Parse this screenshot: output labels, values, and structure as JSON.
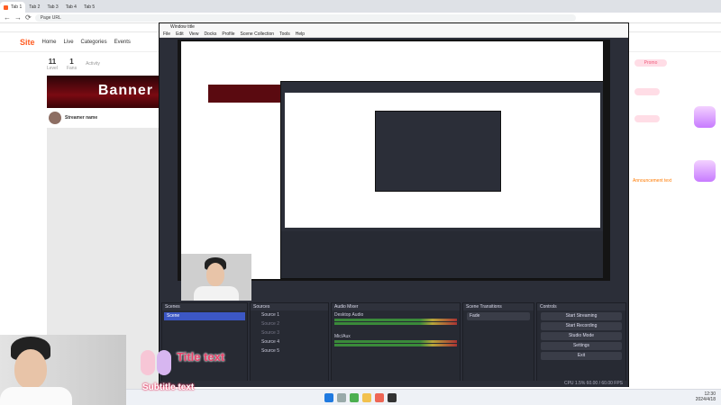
{
  "browser": {
    "tabs": [
      "Tab 1",
      "Tab 2",
      "Tab 3",
      "Tab 4",
      "Tab 5"
    ],
    "url": "Page URL"
  },
  "site": {
    "logo": "Site",
    "nav": [
      "Home",
      "Live",
      "Categories",
      "Events"
    ],
    "stats": [
      {
        "num": "11",
        "label": "Level"
      },
      {
        "num": "1",
        "label": "Fans"
      },
      {
        "num": "",
        "label": "Activity"
      }
    ],
    "banner_text": "Banner",
    "streamer_name": "Streamer name",
    "right_promo": "Promo",
    "right_text": "Announcement text"
  },
  "obs": {
    "title": "Window title",
    "menu": [
      "File",
      "Edit",
      "View",
      "Docks",
      "Profile",
      "Scene Collection",
      "Tools",
      "Help"
    ],
    "docks": {
      "scenes_title": "Scenes",
      "scene_item": "Scene",
      "sources_title": "Sources",
      "sources": [
        "Source 1",
        "Source 2",
        "Source 3",
        "Source 4",
        "Source 5"
      ],
      "mixer_title": "Audio Mixer",
      "mixer_tracks": [
        "Desktop Audio",
        "Mic/Aux"
      ],
      "transitions_title": "Scene Transitions",
      "transition_value": "Fade",
      "controls_title": "Controls",
      "controls": [
        "Start Streaming",
        "Start Recording",
        "Studio Mode",
        "Settings",
        "Exit"
      ]
    },
    "status": "CPU 1.5%   60.00 / 60.00 FPS"
  },
  "sticker": {
    "line1": "Title text",
    "line2": "Subtitle text"
  },
  "taskbar": {
    "time": "12:30",
    "date": "2024/4/18"
  },
  "colors": {
    "accent": "#ff5d23",
    "obs_bg": "#2b2e38",
    "scene_selected": "#3c57c4",
    "promo_pink": "#f05a7a"
  }
}
